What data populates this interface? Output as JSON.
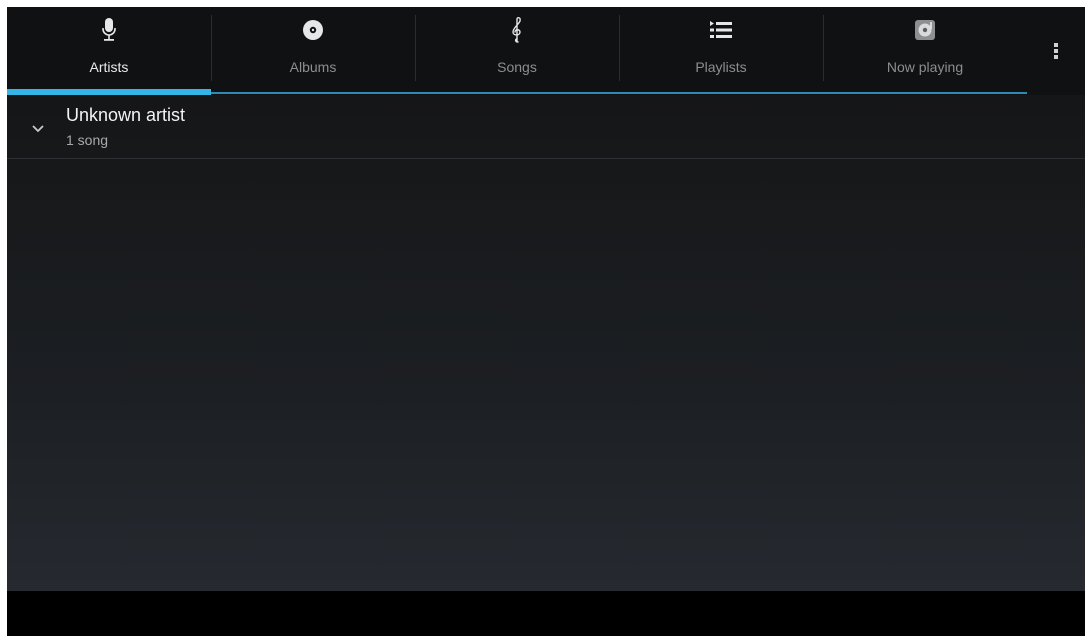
{
  "tabs": [
    {
      "label": "Artists",
      "icon": "microphone-icon",
      "active": true
    },
    {
      "label": "Albums",
      "icon": "disc-icon",
      "active": false
    },
    {
      "label": "Songs",
      "icon": "treble-clef-icon",
      "active": false
    },
    {
      "label": "Playlists",
      "icon": "list-icon",
      "active": false
    },
    {
      "label": "Now playing",
      "icon": "now-playing-icon",
      "active": false
    }
  ],
  "overflow_menu": {
    "icon": "more-vertical-icon"
  },
  "artists": [
    {
      "name": "Unknown artist",
      "count": "1 song",
      "icon": "chevron-down-icon"
    }
  ],
  "colors": {
    "accent": "#33b5e5",
    "tab_active_text": "#e9eaeb",
    "tab_inactive_text": "#8b8e92",
    "background": "#151617"
  }
}
